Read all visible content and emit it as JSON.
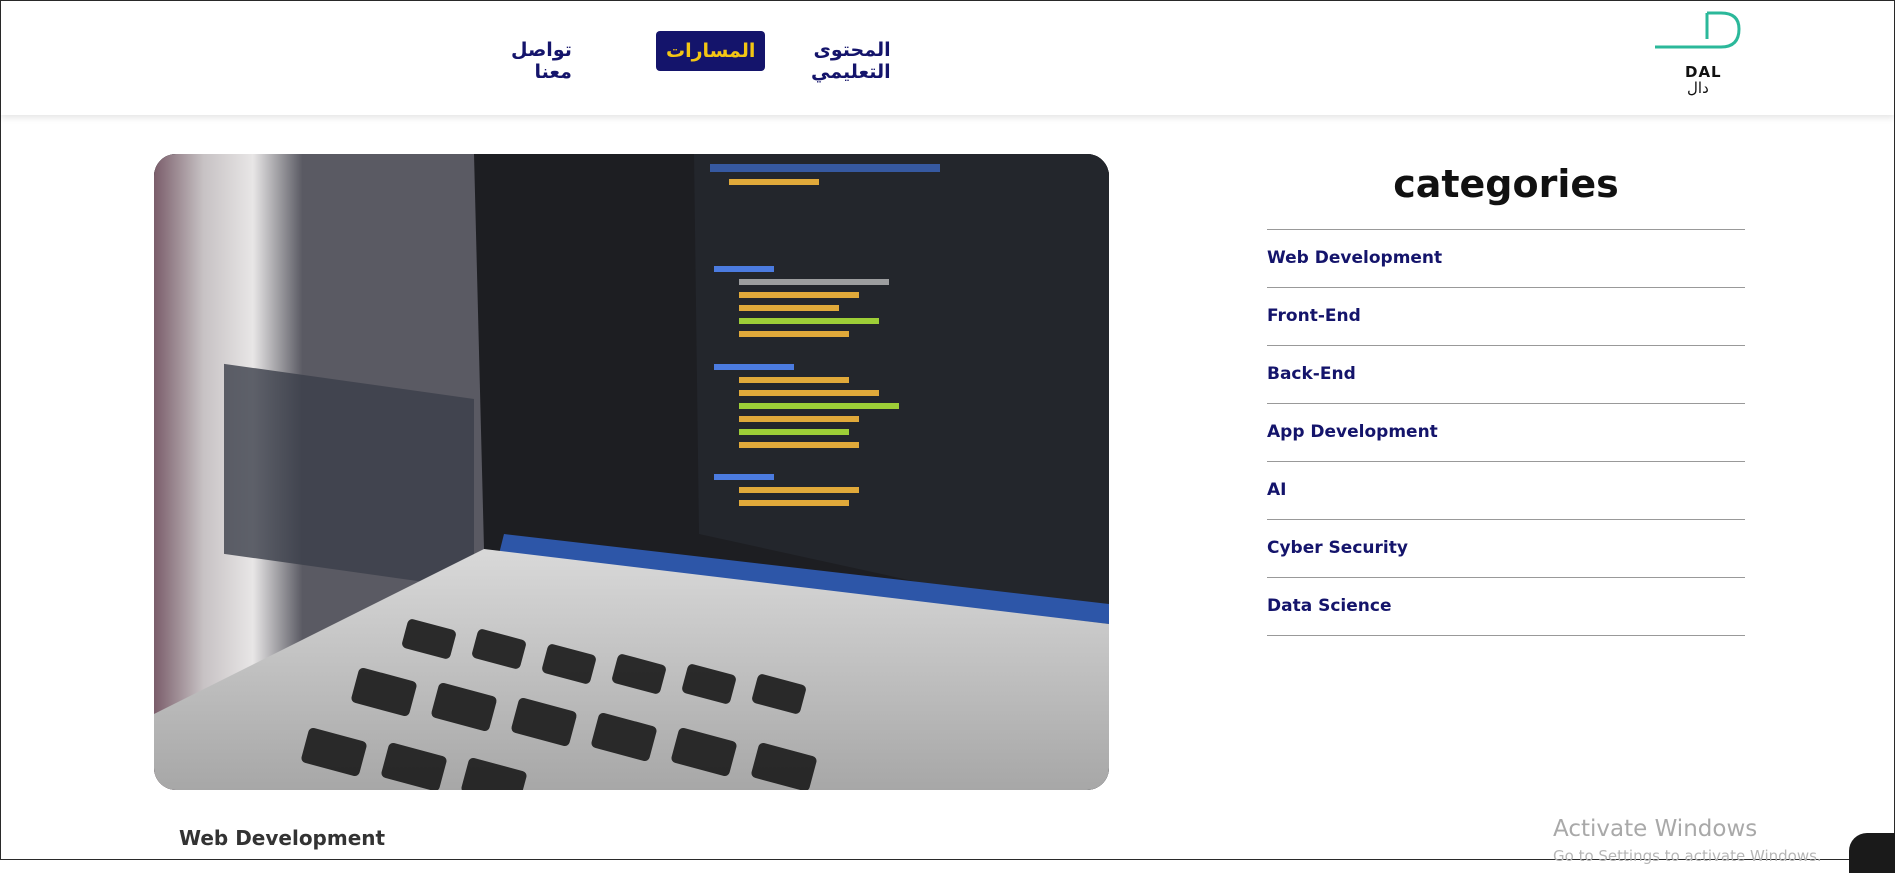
{
  "brand": {
    "name_latin": "DAL",
    "name_arabic": "دال",
    "logo_color": "#2bb89a"
  },
  "nav": {
    "items": [
      {
        "label": "المحتوى التعليمي"
      },
      {
        "label": "المسارات",
        "active": true
      },
      {
        "label": "تواصل معنا"
      }
    ]
  },
  "hero": {
    "image_description": "laptop-with-code-photo"
  },
  "sidebar": {
    "title": "categories",
    "items": [
      {
        "label": "Web Development"
      },
      {
        "label": "Front-End"
      },
      {
        "label": "Back-End"
      },
      {
        "label": "App Development"
      },
      {
        "label": "AI"
      },
      {
        "label": "Cyber Security"
      },
      {
        "label": "Data Science"
      }
    ]
  },
  "card": {
    "title": "Web Development"
  },
  "system": {
    "watermark_title": "Activate Windows",
    "watermark_sub": "Go to Settings to activate Windows."
  },
  "colors": {
    "primary": "#14146b",
    "accent": "#f3c614"
  }
}
